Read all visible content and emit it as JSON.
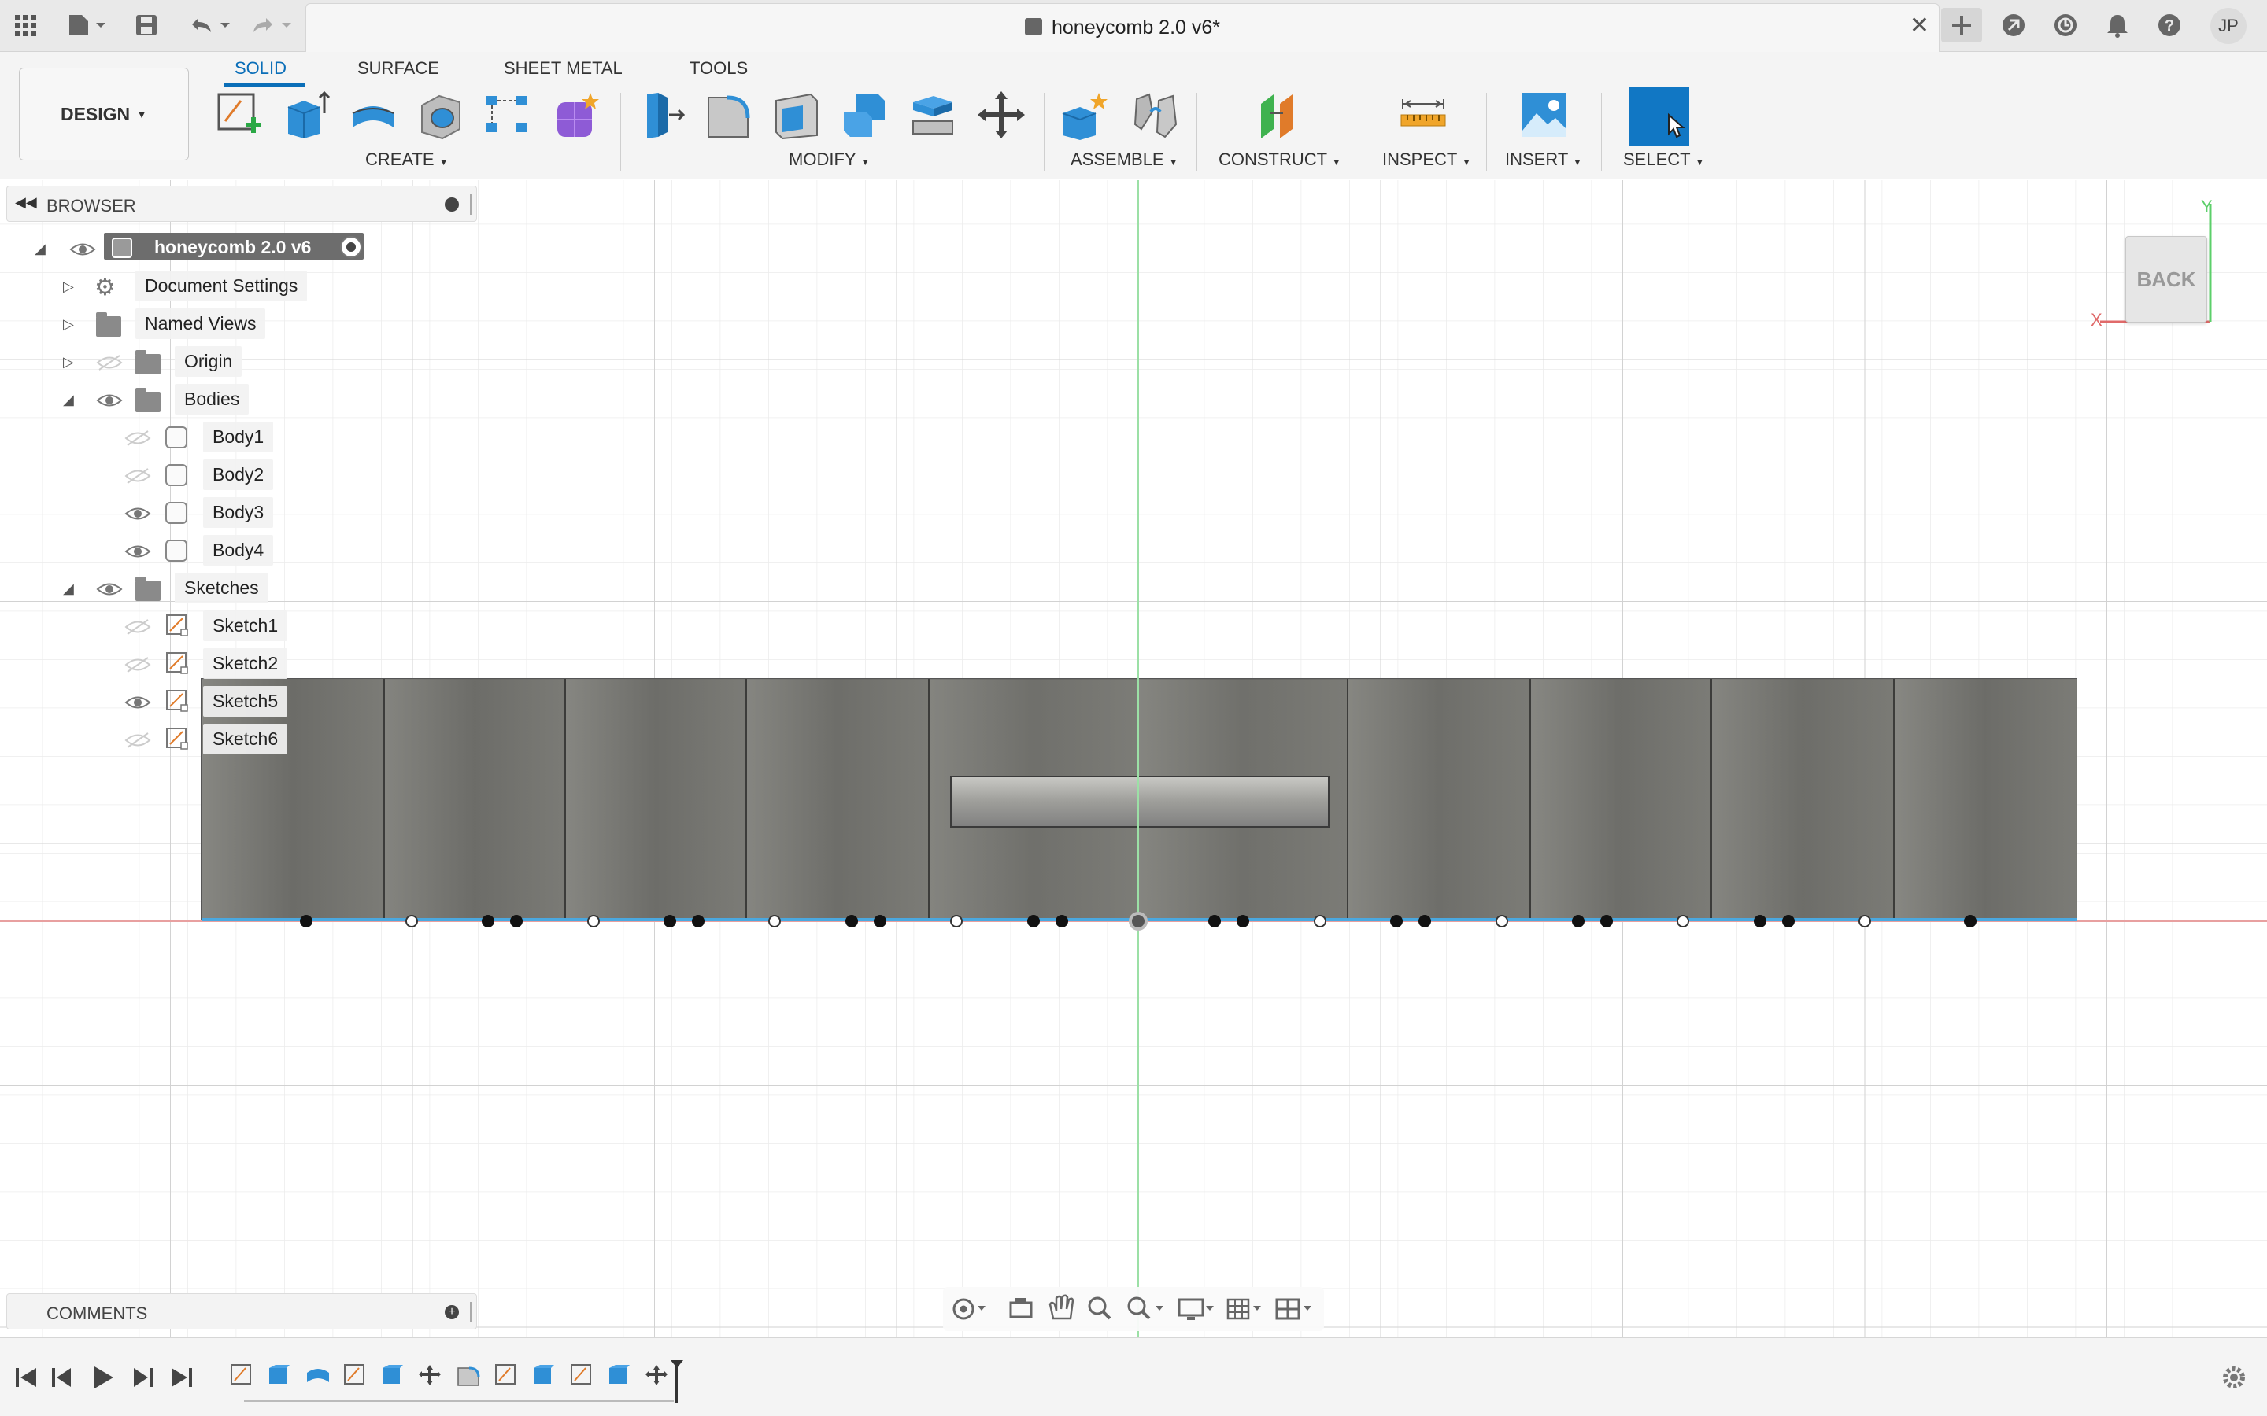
{
  "title_bar": {
    "document_title": "honeycomb 2.0 v6*",
    "user_initials": "JP"
  },
  "toolbar": {
    "workspace_tabs": [
      "SOLID",
      "SURFACE",
      "SHEET METAL",
      "TOOLS"
    ],
    "active_tab": "SOLID",
    "workspace_button": "DESIGN",
    "groups": {
      "create": "CREATE",
      "modify": "MODIFY",
      "assemble": "ASSEMBLE",
      "construct": "CONSTRUCT",
      "inspect": "INSPECT",
      "insert": "INSERT",
      "select": "SELECT"
    },
    "accent_color": "#0a6eb8",
    "select_active_color": "#1177c4"
  },
  "browser": {
    "header": "BROWSER",
    "root": "honeycomb 2.0 v6",
    "items": [
      {
        "label": "Document Settings"
      },
      {
        "label": "Named Views"
      },
      {
        "label": "Origin"
      },
      {
        "label": "Bodies"
      },
      {
        "label": "Body1"
      },
      {
        "label": "Body2"
      },
      {
        "label": "Body3"
      },
      {
        "label": "Body4"
      },
      {
        "label": "Sketches"
      },
      {
        "label": "Sketch1"
      },
      {
        "label": "Sketch2"
      },
      {
        "label": "Sketch5"
      },
      {
        "label": "Sketch6"
      }
    ]
  },
  "comments": {
    "header": "COMMENTS"
  },
  "viewcube": {
    "face": "BACK",
    "axis_x": "X",
    "axis_y": "Y"
  },
  "colors": {
    "model_body": "#6f6f6a",
    "axis_red": "#e06a6a",
    "axis_green": "#5ccf6a",
    "sketch_line": "#4aa8e0"
  }
}
